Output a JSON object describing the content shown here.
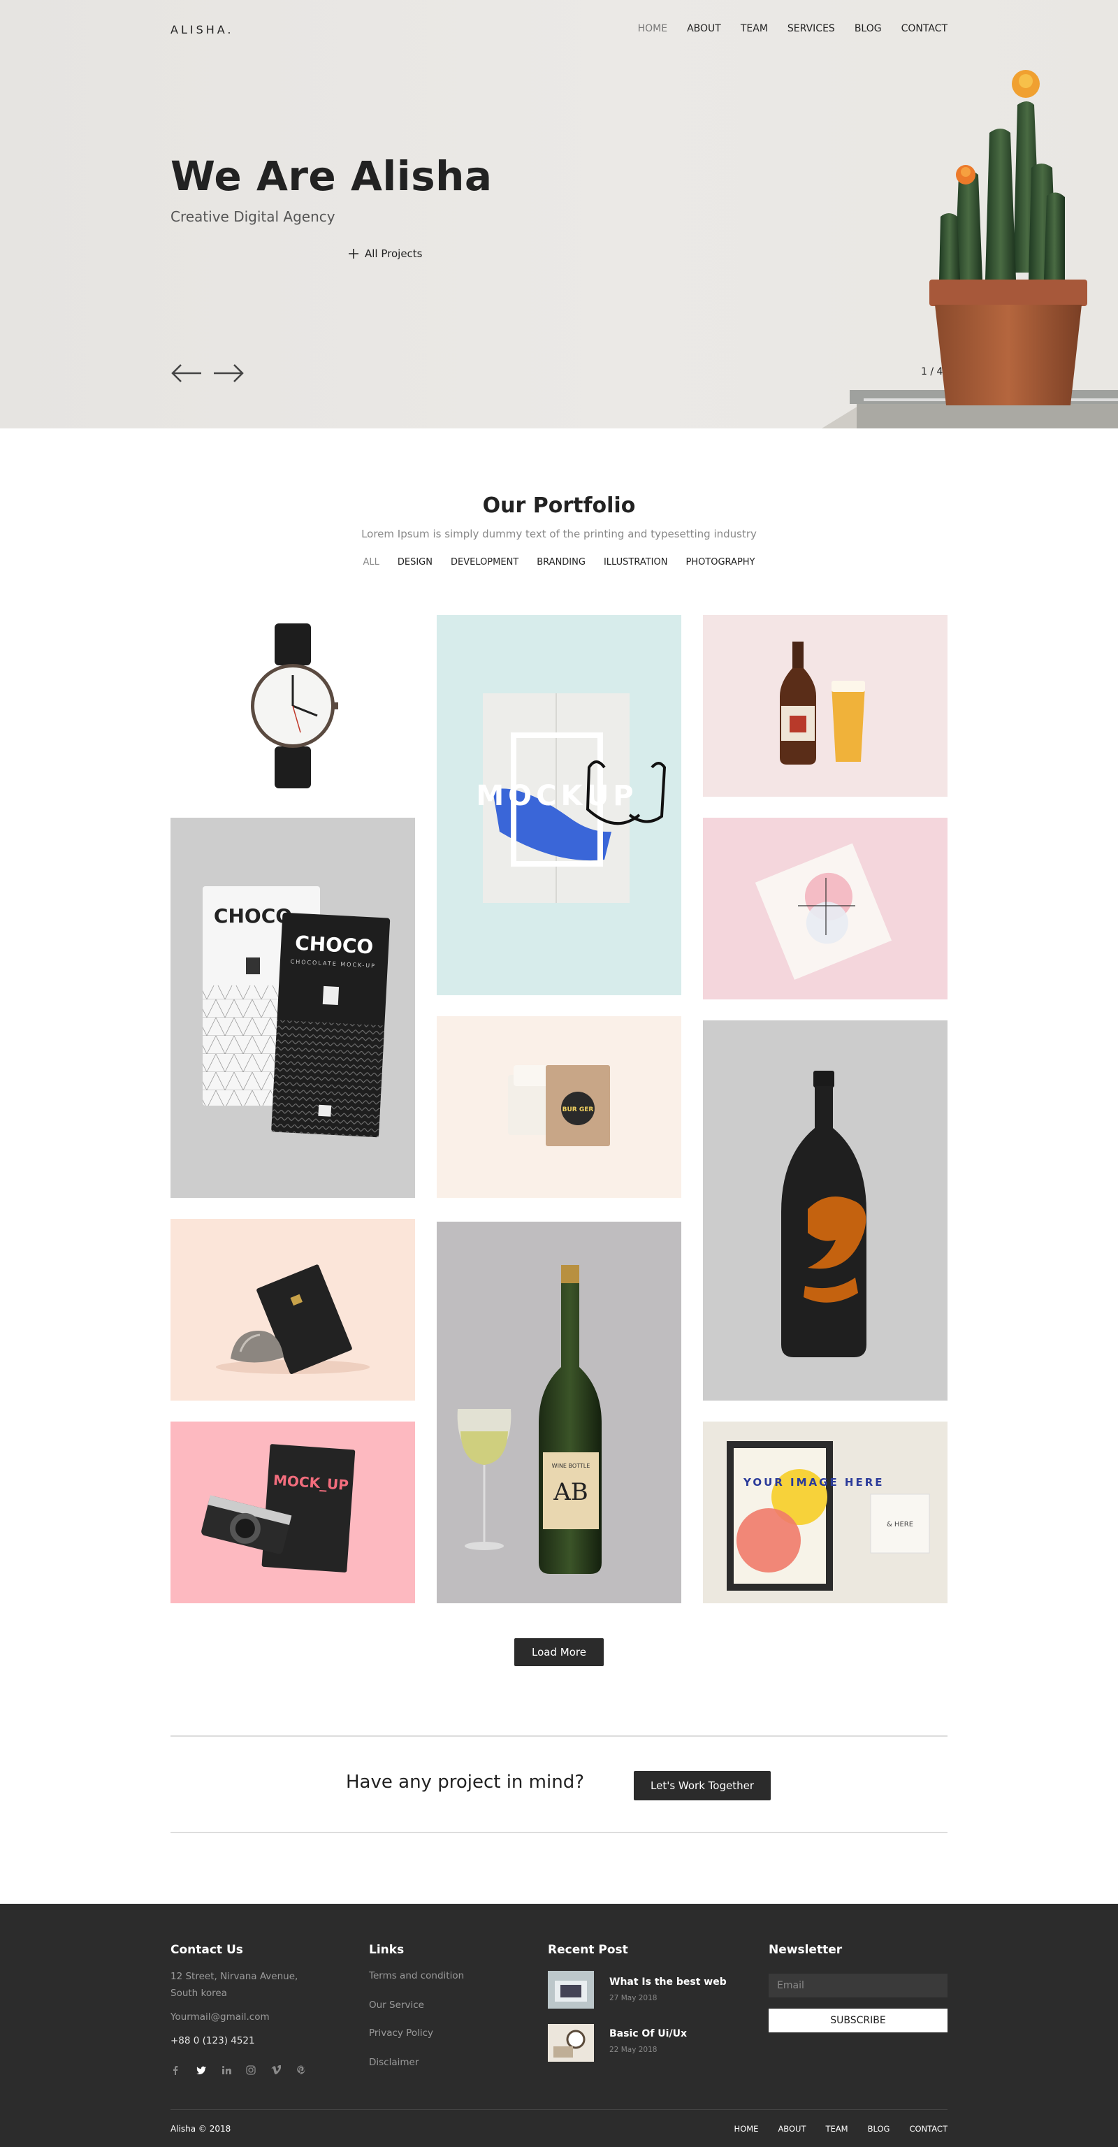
{
  "header": {
    "logo": "ALISHA.",
    "nav": [
      "HOME",
      "ABOUT",
      "TEAM",
      "SERVICES",
      "BLOG",
      "CONTACT"
    ],
    "active_nav": "HOME"
  },
  "hero": {
    "title": "We Are Alisha",
    "subtitle": "Creative Digital Agency",
    "link_label": "All Projects",
    "slide_counter": "1 / 4"
  },
  "portfolio": {
    "title": "Our Portfolio",
    "subtitle": "Lorem Ipsum is simply dummy text of the printing and typesetting industry",
    "filters": [
      "ALL",
      "DESIGN",
      "DEVELOPMENT",
      "BRANDING",
      "ILLUSTRATION",
      "PHOTOGRAPHY"
    ],
    "active_filter": "ALL",
    "tiles": {
      "choco_a": "CHOCO",
      "choco_b": "CHOCO",
      "choco_sub": "CHOCOLATE MOCK-UP",
      "mock_letters": "MOCKUP",
      "burger": "BUR GER",
      "mockup_book": "MOCK_UP",
      "wine_label": "AB",
      "wine_brand": "WINE BOTTLE",
      "poster": "YOUR IMAGE HERE",
      "small_card": "& HERE"
    },
    "load_more": "Load More"
  },
  "cta": {
    "text": "Have any project in mind?",
    "button": "Let's Work Together"
  },
  "footer": {
    "contact": {
      "title": "Contact Us",
      "address_line1": "12 Street, Nirvana Avenue,",
      "address_line2": "South korea",
      "email": "Yourmail@gmail.com",
      "phone": "+88 0 (123) 4521",
      "social_icons": [
        "facebook-icon",
        "twitter-icon",
        "linkedin-icon",
        "instagram-icon",
        "vimeo-icon",
        "pinterest-icon"
      ]
    },
    "links": {
      "title": "Links",
      "items": [
        "Terms and condition",
        "Our Service",
        "Privacy Policy",
        "Disclaimer"
      ]
    },
    "recent_post": {
      "title": "Recent Post",
      "posts": [
        {
          "title": "What Is the best web",
          "date": "27 May 2018"
        },
        {
          "title": "Basic Of Ui/Ux",
          "date": "22 May 2018"
        }
      ]
    },
    "newsletter": {
      "title": "Newsletter",
      "placeholder": "Email",
      "button": "SUBSCRIBE"
    },
    "copyright": "Alisha © 2018",
    "bottom_nav": [
      "HOME",
      "ABOUT",
      "TEAM",
      "BLOG",
      "CONTACT"
    ]
  }
}
